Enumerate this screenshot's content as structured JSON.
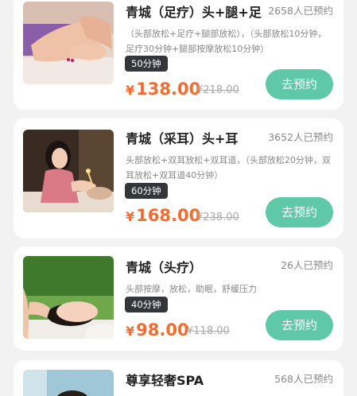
{
  "services": [
    {
      "title": "青城（足疗）头+腿+足",
      "count": "2658人已预约",
      "desc": "（头部放松+足疗+腿部放松），（头部放松10分钟，足疗30分钟+腿部按摩放松10分钟）",
      "duration": "50分钟",
      "currency": "¥",
      "price": "138.00",
      "original": "¥218.00",
      "button": "去预约"
    },
    {
      "title": "青城（采耳）头+耳",
      "count": "3652人已预约",
      "desc": "头部放松+双耳放松+双耳道，（头部放松20分钟，双耳放松+双耳道40分钟）",
      "duration": "60分钟",
      "currency": "¥",
      "price": "168.00",
      "original": "¥238.00",
      "button": "去预约"
    },
    {
      "title": "青城（头疗）",
      "count": "26人已预约",
      "desc": "头部按摩，放松，助眠，舒缓压力",
      "duration": "40分钟",
      "currency": "¥",
      "price": "98.00",
      "original": "¥118.00",
      "button": "去预约"
    },
    {
      "title": "尊享轻奢SPA",
      "count": "568人已预约"
    }
  ]
}
